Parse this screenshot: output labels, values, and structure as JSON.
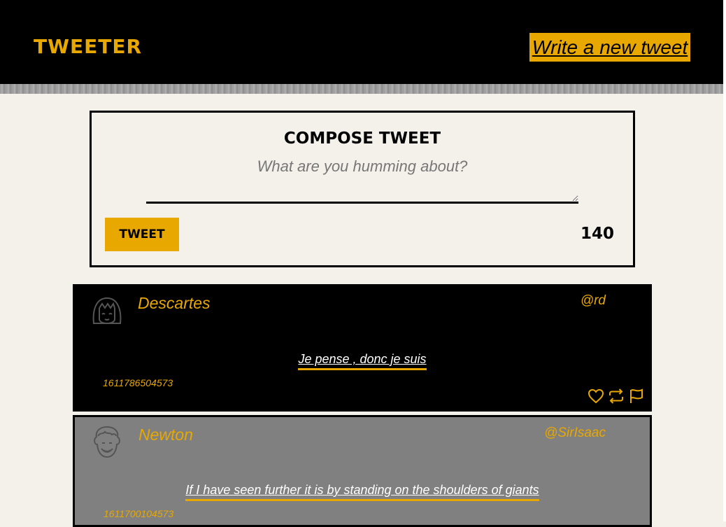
{
  "nav": {
    "brand": "TWEETER",
    "write_label": "Write a new tweet"
  },
  "compose": {
    "title": "COMPOSE TWEET",
    "placeholder": "What are you humming about?",
    "button_label": "TWEET",
    "counter": "140"
  },
  "tweets": [
    {
      "name": "Descartes",
      "handle": "@rd",
      "content": "Je pense , donc je suis",
      "timestamp": "1611786504573",
      "avatar_icon": "girl-avatar-icon"
    },
    {
      "name": "Newton",
      "handle": "@SirIsaac",
      "content": "If I have seen further it is by standing on the shoulders of giants",
      "timestamp": "1611700104573",
      "avatar_icon": "man-avatar-icon"
    }
  ],
  "colors": {
    "accent": "#e8a800",
    "nav_bg": "#000000",
    "page_bg": "#f4f1ea",
    "tweet_hover_bg": "#808080"
  }
}
